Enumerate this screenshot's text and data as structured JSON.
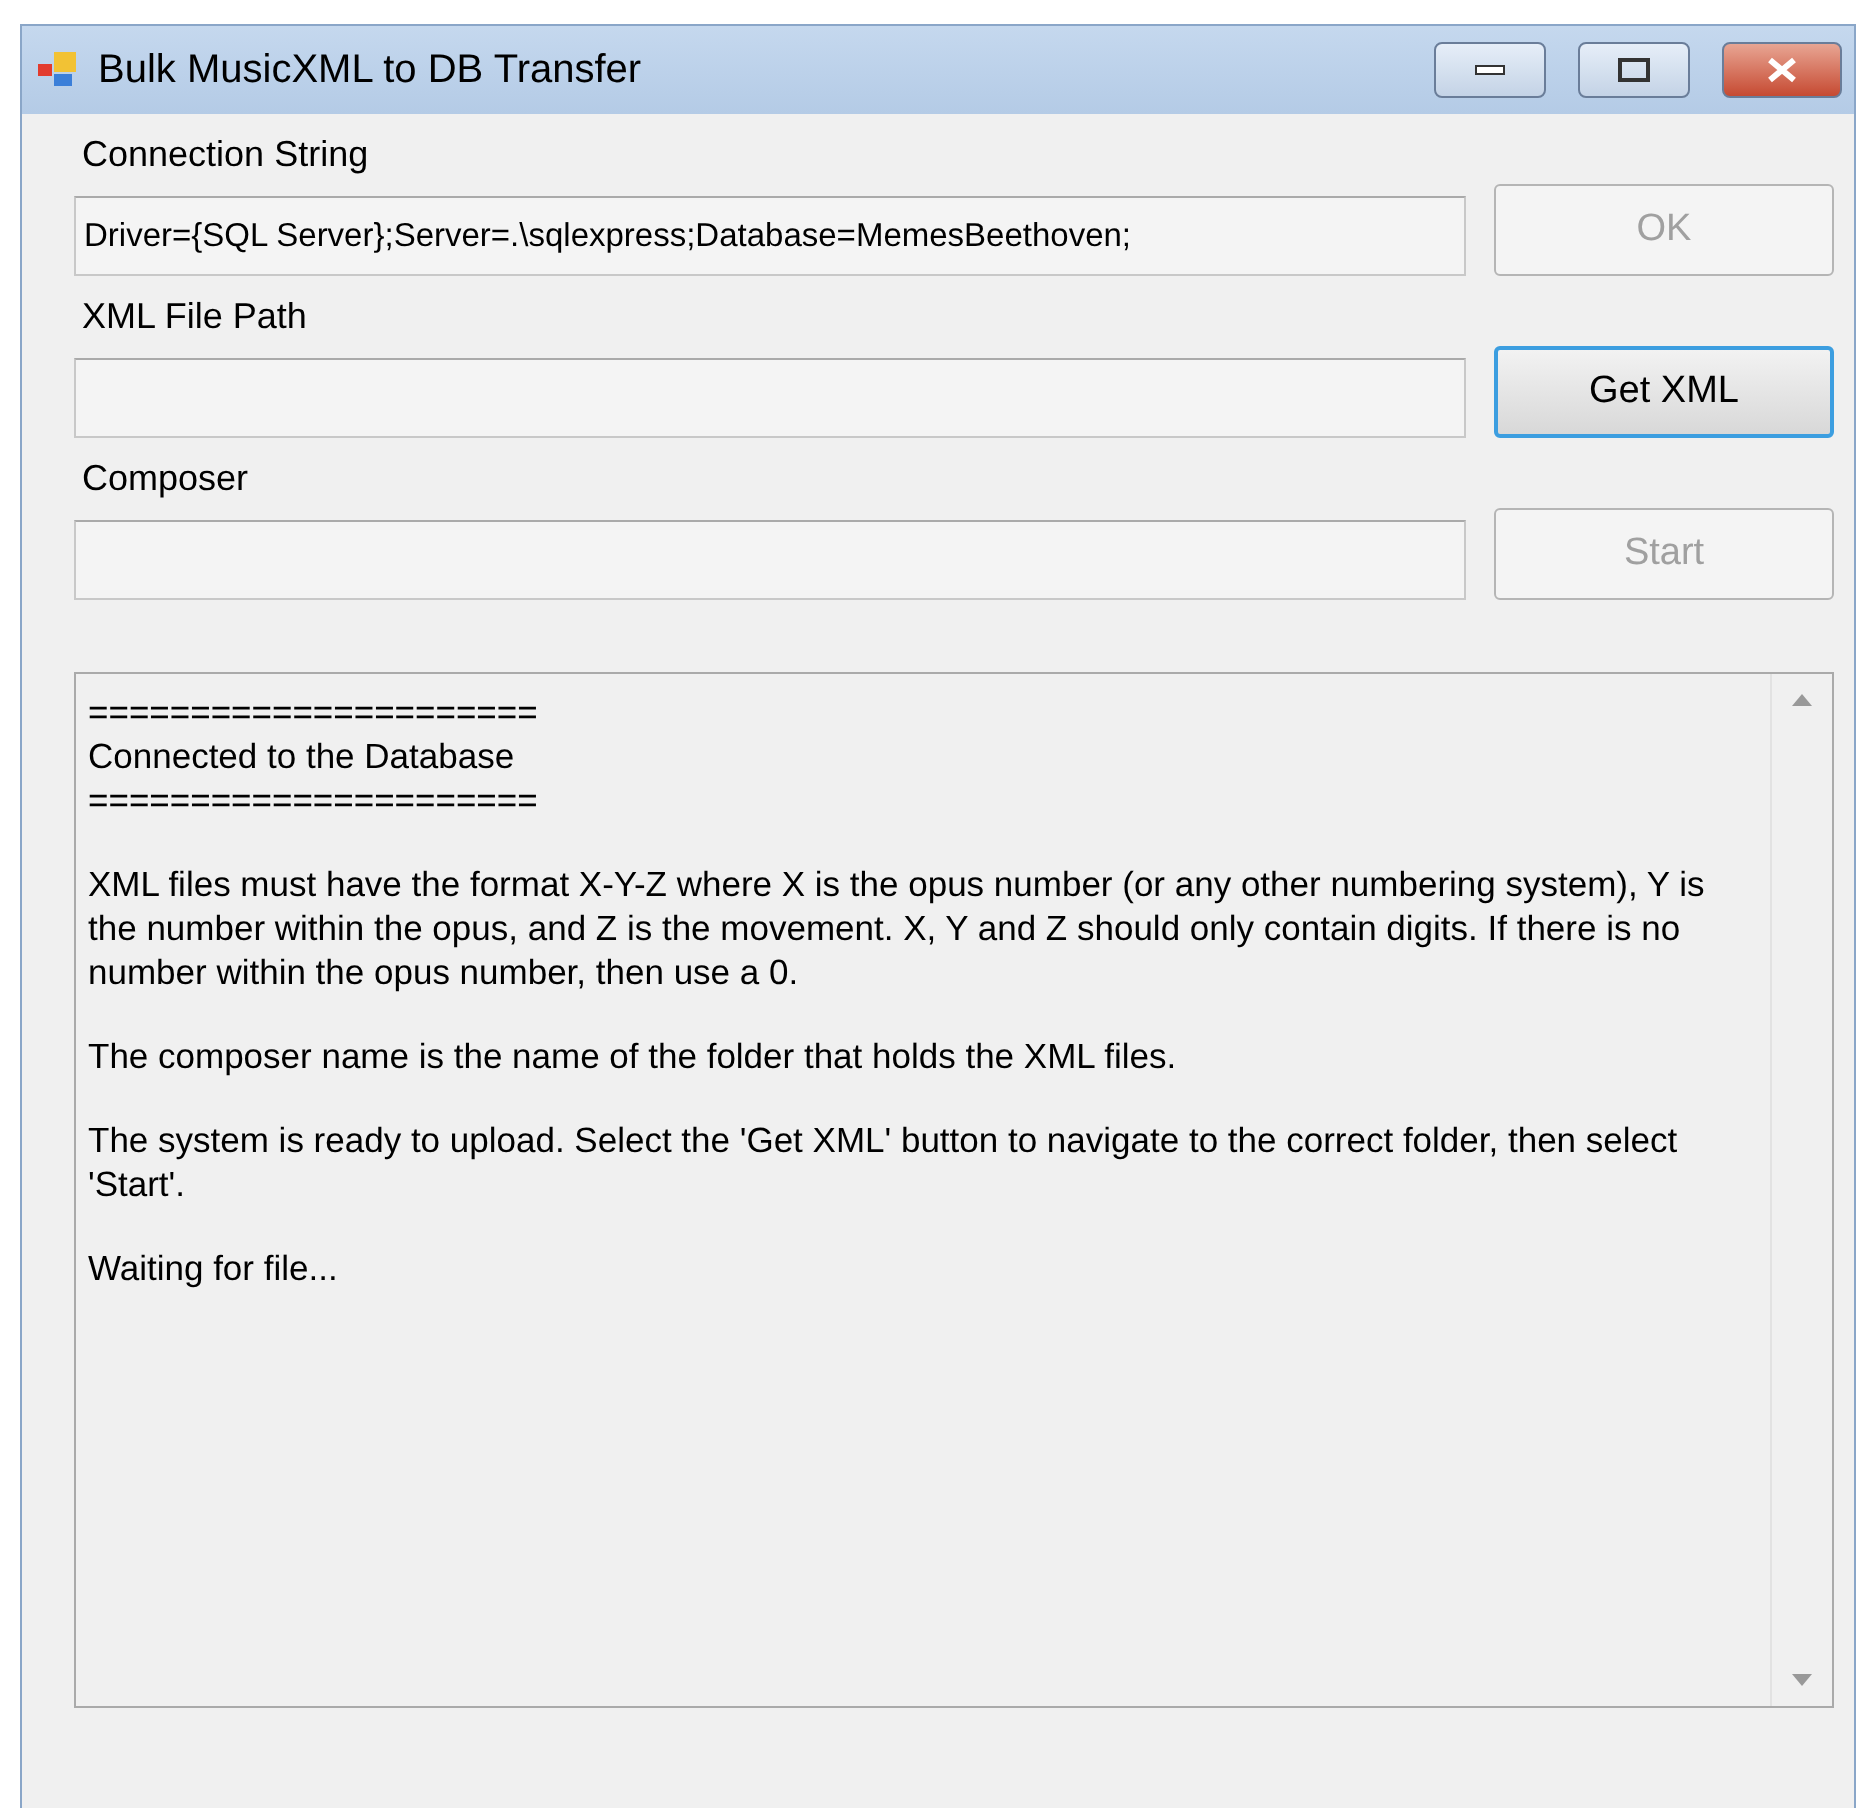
{
  "window": {
    "title": "Bulk MusicXML to DB Transfer"
  },
  "fields": [
    {
      "label": "Connection String",
      "value": "Driver={SQL Server};Server=.\\sqlexpress;Database=MemesBeethoven;",
      "button": {
        "label": "OK",
        "disabled": true,
        "focused": false
      }
    },
    {
      "label": "XML File Path",
      "button": {
        "label": "Get XML",
        "disabled": false,
        "focused": true
      }
    },
    {
      "label": "Composer",
      "button": {
        "label": "Start",
        "disabled": true,
        "focused": false
      }
    }
  ],
  "log": [
    {
      "lines": [
        "======================",
        "Connected to the Database",
        "======================"
      ]
    },
    {
      "lines": [
        "XML files must have the format X-Y-Z where X is the opus number (or any other numbering system), Y is the number within the opus, and Z is the movement.  X, Y and Z should only contain digits.  If there is no number within the opus number, then use a 0."
      ]
    },
    {
      "lines": [
        "The composer name is the name of the folder that holds the XML files."
      ]
    },
    {
      "lines": [
        "The system is ready to upload.  Select the 'Get XML' button to navigate to the correct folder, then select 'Start'."
      ]
    },
    {
      "lines": [
        "Waiting for file..."
      ]
    }
  ]
}
